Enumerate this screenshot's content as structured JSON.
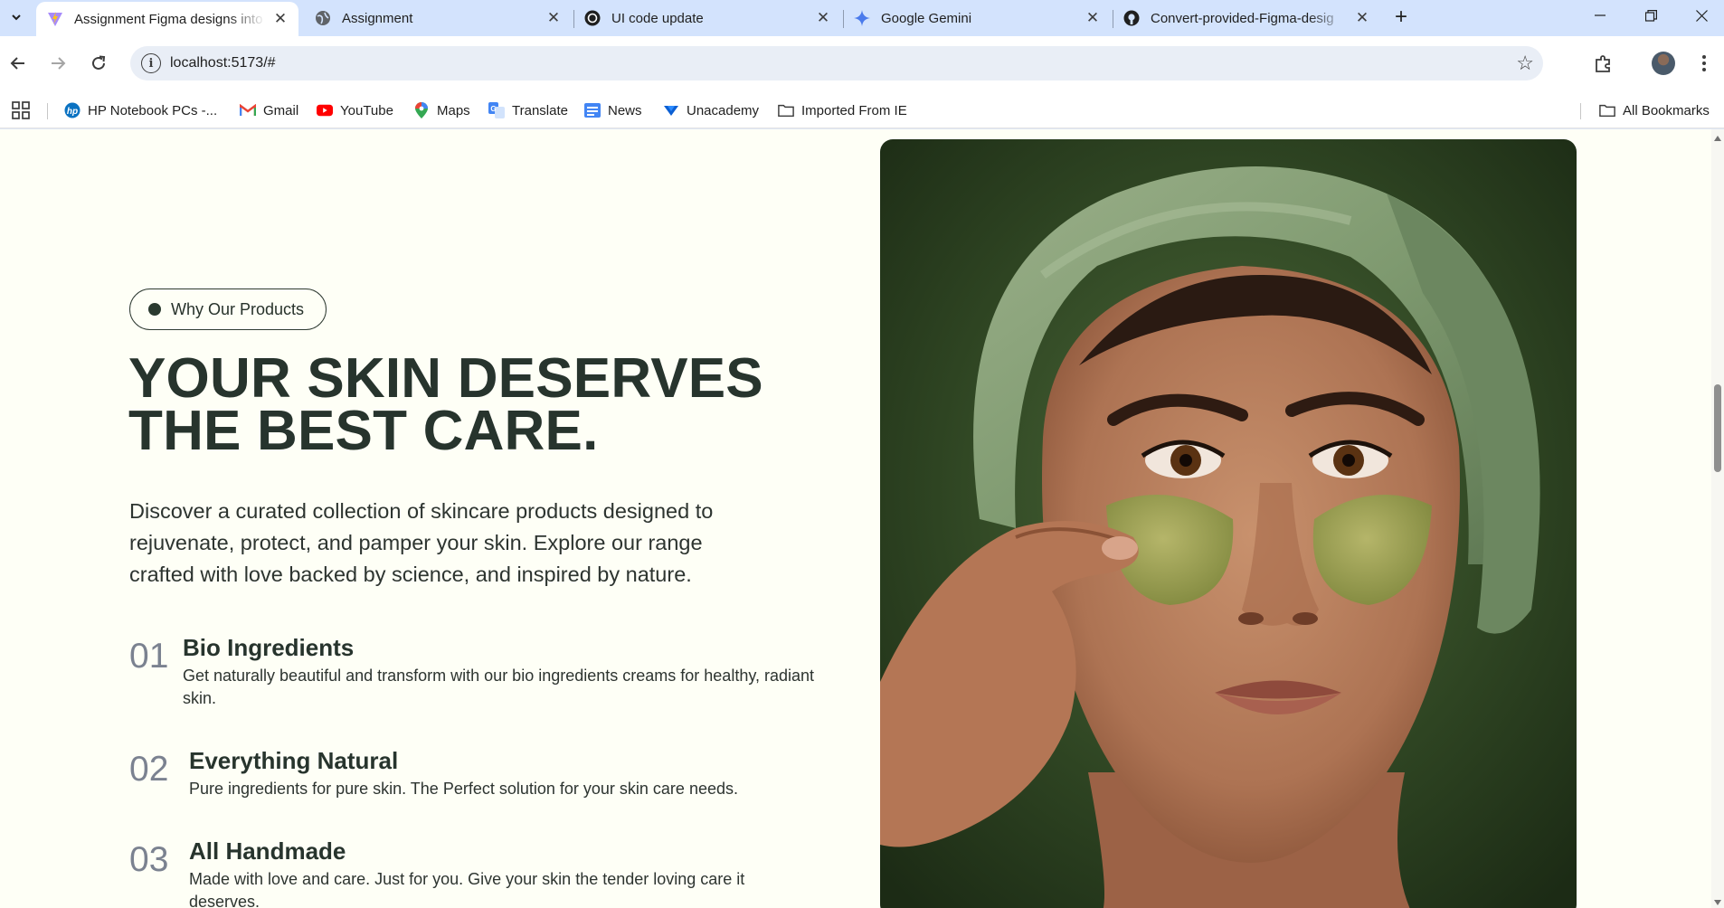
{
  "browser": {
    "tabs": [
      {
        "label": "Assignment Figma designs into",
        "favicon": "vite-icon",
        "active": true
      },
      {
        "label": "Assignment",
        "favicon": "globe-icon",
        "active": false
      },
      {
        "label": "UI code update",
        "favicon": "chatgpt-icon",
        "active": false
      },
      {
        "label": "Google Gemini",
        "favicon": "gemini-icon",
        "active": false
      },
      {
        "label": "Convert-provided-Figma-desig",
        "favicon": "github-icon",
        "active": false
      }
    ],
    "new_tab_icon": "plus-icon",
    "url": "localhost:5173/#"
  },
  "bookmarks": [
    {
      "label": "HP Notebook PCs -...",
      "icon": "hp-icon"
    },
    {
      "label": "Gmail",
      "icon": "gmail-icon"
    },
    {
      "label": "YouTube",
      "icon": "youtube-icon"
    },
    {
      "label": "Maps",
      "icon": "maps-icon"
    },
    {
      "label": "Translate",
      "icon": "translate-icon"
    },
    {
      "label": "News",
      "icon": "news-icon"
    },
    {
      "label": "Unacademy",
      "icon": "unacademy-icon"
    },
    {
      "label": "Imported From IE",
      "icon": "folder-icon"
    }
  ],
  "all_bookmarks_label": "All Bookmarks",
  "page": {
    "badge": "Why Our Products",
    "title_line1": "YOUR SKIN DESERVES",
    "title_line2": "THE BEST CARE.",
    "description": "Discover a curated collection of skincare products designed to rejuvenate, protect, and pamper your skin. Explore our range crafted with love backed by science, and inspired by nature.",
    "features": [
      {
        "number": "01",
        "title": "Bio Ingredients",
        "text": "Get naturally beautiful and transform with our bio ingredients creams for healthy, radiant skin."
      },
      {
        "number": "02",
        "title": "Everything Natural",
        "text": "Pure ingredients for pure skin. The Perfect solution for your skin care needs."
      },
      {
        "number": "03",
        "title": "All Handmade",
        "text": "Made with love and care. Just for you. Give your skin the tender loving care it deserves."
      }
    ]
  },
  "colors": {
    "page_bg": "#fefff6",
    "heading": "#27342d",
    "tabstrip_bg": "#d3e3fd",
    "towel": "#7f9a70"
  }
}
